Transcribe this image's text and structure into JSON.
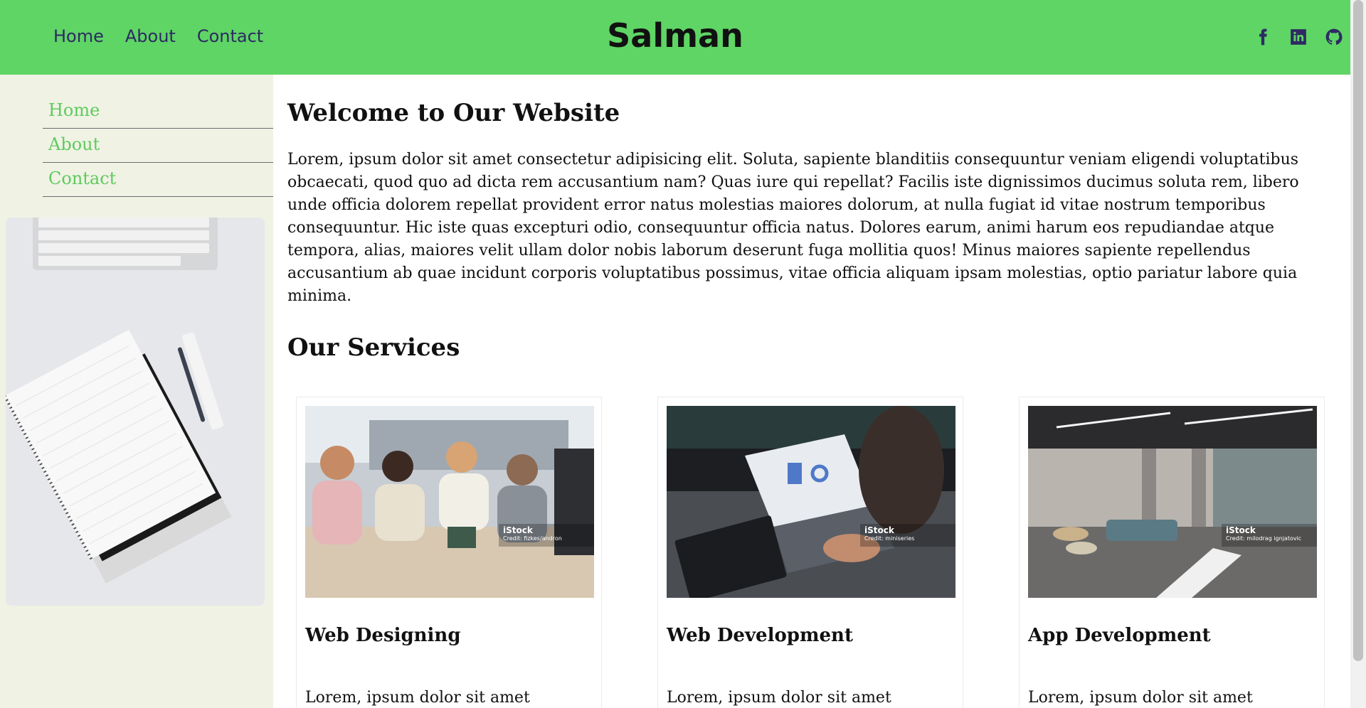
{
  "header": {
    "nav": [
      "Home",
      "About",
      "Contact"
    ],
    "brand": "Salman",
    "socials": [
      "facebook-icon",
      "linkedin-icon",
      "github-icon"
    ],
    "color": "#5ed564"
  },
  "sidebar": {
    "items": [
      "Home",
      "About",
      "Contact"
    ],
    "background": "#f0f2e4",
    "link_color": "#5ecb5e"
  },
  "main": {
    "title": "Welcome to Our Website",
    "intro": "Lorem, ipsum dolor sit amet consectetur adipisicing elit. Soluta, sapiente blanditiis consequuntur veniam eligendi voluptatibus obcaecati, quod quo ad dicta rem accusantium nam? Quas iure qui repellat? Facilis iste dignissimos ducimus soluta rem, libero unde officia dolorem repellat provident error natus molestias maiores dolorum, at nulla fugiat id vitae nostrum temporibus consequuntur. Hic iste quas excepturi odio, consequuntur officia natus. Dolores earum, animi harum eos repudiandae atque tempora, alias, maiores velit ullam dolor nobis laborum deserunt fuga mollitia quos! Minus maiores sapiente repellendus accusantium ab quae incidunt corporis voluptatibus possimus, vitae officia aliquam ipsam molestias, optio pariatur labore quia minima.",
    "services_title": "Our Services",
    "cards": [
      {
        "title": "Web Designing",
        "text": "Lorem, ipsum dolor sit amet",
        "watermark": "iStock",
        "credit": "Credit: fizkes/andron"
      },
      {
        "title": "Web Development",
        "text": "Lorem, ipsum dolor sit amet",
        "watermark": "iStock",
        "credit": "Credit: miniseries"
      },
      {
        "title": "App Development",
        "text": "Lorem, ipsum dolor sit amet",
        "watermark": "iStock",
        "credit": "Credit: milodrag ignjatovic"
      }
    ]
  }
}
